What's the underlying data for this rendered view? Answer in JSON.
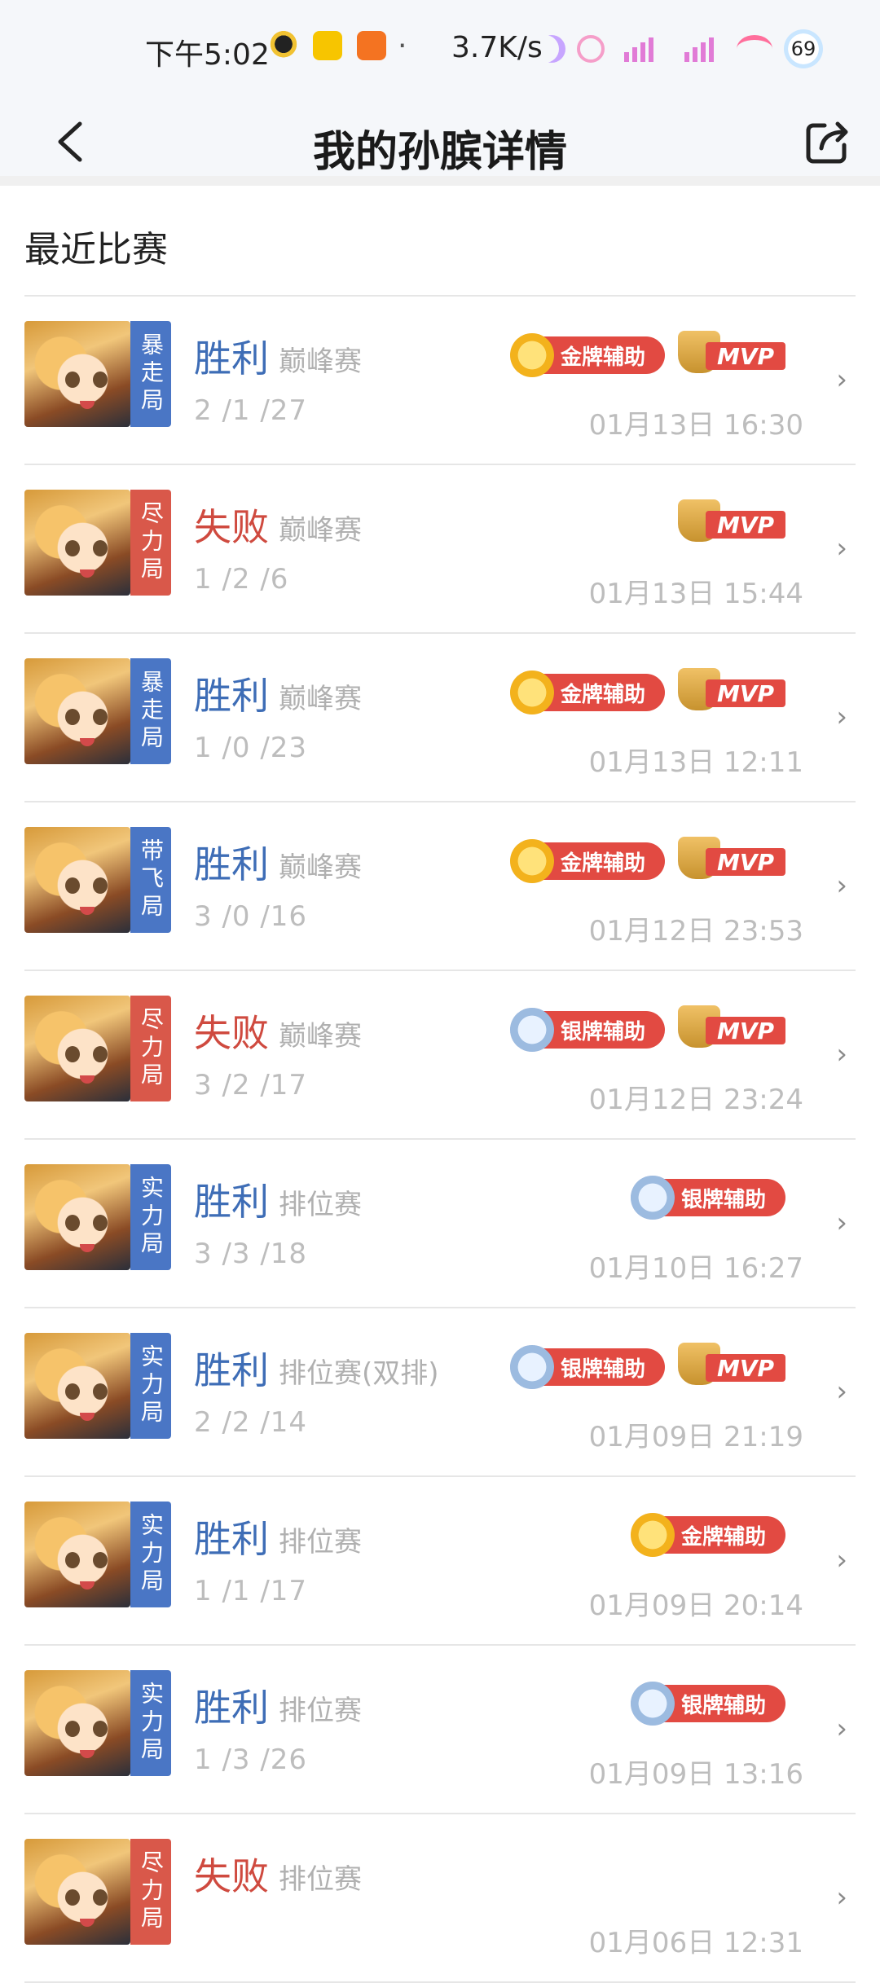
{
  "status_bar": {
    "time": "下午5:02",
    "net_speed": "3.7K/s",
    "battery": "69",
    "icons": [
      "qq-icon",
      "app-icon",
      "app-icon",
      "moon-icon",
      "alarm-icon",
      "signal-hd-icon",
      "signal-hd-icon",
      "wifi-icon",
      "battery-icon"
    ]
  },
  "nav": {
    "title": "我的孙膑详情",
    "back_icon": "chevron-left-icon",
    "share_icon": "share-icon"
  },
  "section": {
    "title": "最近比赛"
  },
  "matches": [
    {
      "tag": "暴走局",
      "tag_color": "blue",
      "result": "胜利",
      "result_type": "win",
      "mode": "巅峰赛",
      "kda": "2 /1 /27",
      "time": "01月13日 16:30",
      "badges": [
        "金牌辅助",
        "MVP"
      ]
    },
    {
      "tag": "尽力局",
      "tag_color": "red",
      "result": "失败",
      "result_type": "lose",
      "mode": "巅峰赛",
      "kda": "1 /2 /6",
      "time": "01月13日 15:44",
      "badges": [
        "MVP"
      ]
    },
    {
      "tag": "暴走局",
      "tag_color": "blue",
      "result": "胜利",
      "result_type": "win",
      "mode": "巅峰赛",
      "kda": "1 /0 /23",
      "time": "01月13日 12:11",
      "badges": [
        "金牌辅助",
        "MVP"
      ]
    },
    {
      "tag": "带飞局",
      "tag_color": "blue",
      "result": "胜利",
      "result_type": "win",
      "mode": "巅峰赛",
      "kda": "3 /0 /16",
      "time": "01月12日 23:53",
      "badges": [
        "金牌辅助",
        "MVP"
      ]
    },
    {
      "tag": "尽力局",
      "tag_color": "red",
      "result": "失败",
      "result_type": "lose",
      "mode": "巅峰赛",
      "kda": "3 /2 /17",
      "time": "01月12日 23:24",
      "badges": [
        "银牌辅助",
        "MVP"
      ]
    },
    {
      "tag": "实力局",
      "tag_color": "blue",
      "result": "胜利",
      "result_type": "win",
      "mode": "排位赛",
      "kda": "3 /3 /18",
      "time": "01月10日 16:27",
      "badges": [
        "银牌辅助"
      ]
    },
    {
      "tag": "实力局",
      "tag_color": "blue",
      "result": "胜利",
      "result_type": "win",
      "mode": "排位赛(双排)",
      "kda": "2 /2 /14",
      "time": "01月09日 21:19",
      "badges": [
        "银牌辅助",
        "MVP"
      ]
    },
    {
      "tag": "实力局",
      "tag_color": "blue",
      "result": "胜利",
      "result_type": "win",
      "mode": "排位赛",
      "kda": "1 /1 /17",
      "time": "01月09日 20:14",
      "badges": [
        "金牌辅助"
      ]
    },
    {
      "tag": "实力局",
      "tag_color": "blue",
      "result": "胜利",
      "result_type": "win",
      "mode": "排位赛",
      "kda": "1 /3 /26",
      "time": "01月09日 13:16",
      "badges": [
        "银牌辅助"
      ]
    },
    {
      "tag": "尽力局",
      "tag_color": "red",
      "result": "失败",
      "result_type": "lose",
      "mode": "排位赛",
      "kda": "",
      "time": "01月06日 12:31",
      "badges": []
    }
  ],
  "colors": {
    "win": "#3e6db6",
    "lose": "#cf4a3f",
    "tag_blue": "#4a76c5",
    "tag_red": "#d9584a",
    "badge_red": "#e24a42"
  }
}
